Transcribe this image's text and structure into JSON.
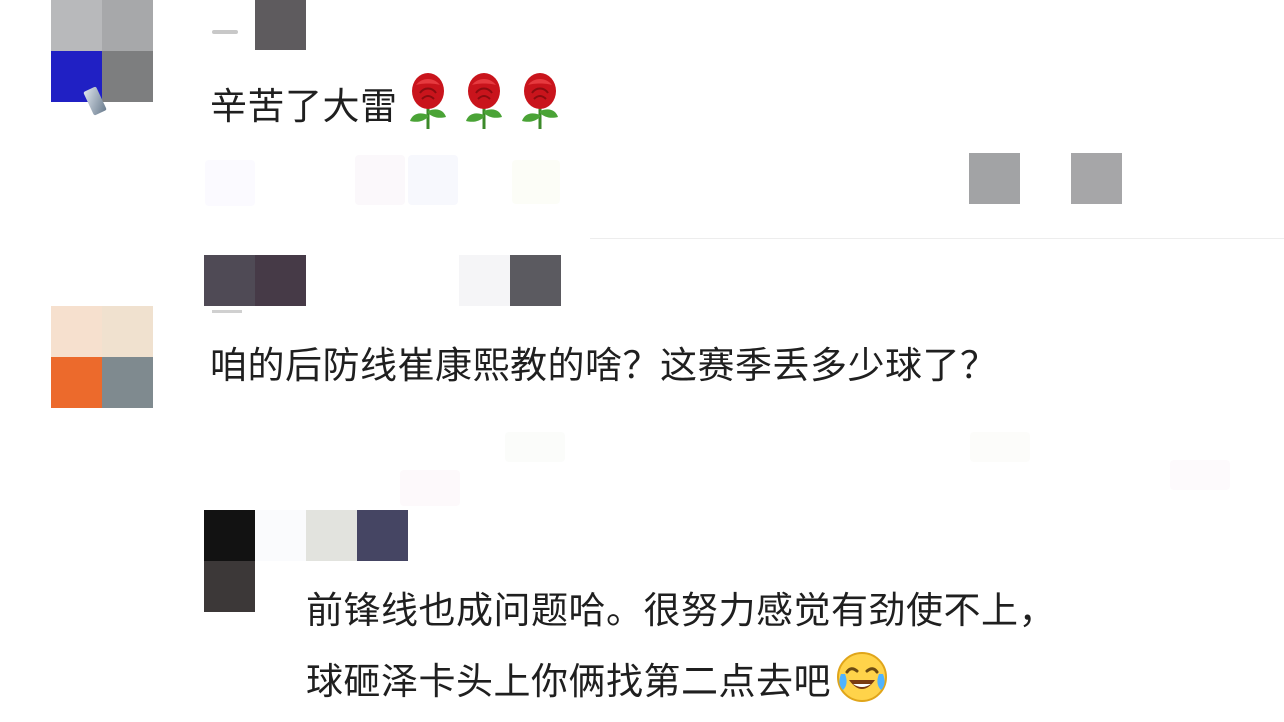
{
  "comments": [
    {
      "text": "辛苦了大雷",
      "emoji": [
        "rose-emoji",
        "rose-emoji",
        "rose-emoji"
      ]
    },
    {
      "text": "咱的后防线崔康熙教的啥？这赛季丢多少球了？"
    },
    {
      "reply": true,
      "line1": "前锋线也成问题哈。很努力感觉有劲使不上，",
      "line2": "球砸泽卡头上你俩找第二点去吧",
      "emoji": [
        "laughing-crying-emoji"
      ]
    }
  ],
  "colors": {
    "text": "#1f1f1f",
    "divider": "#ededed",
    "rose": "#c9141c"
  }
}
